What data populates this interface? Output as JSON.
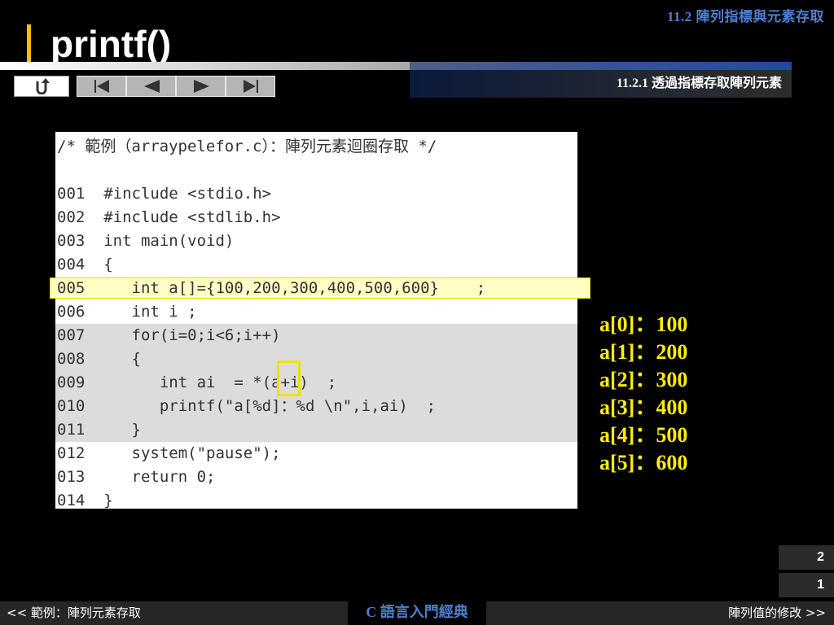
{
  "header": {
    "chapter": "11.2  陣列指標與元素存取",
    "title": "printf()",
    "subsection": "11.2.1 透過指標存取陣列元素"
  },
  "nav": {
    "back_icon": "return-arrow-icon",
    "controls": [
      "first-slide-icon",
      "previous-slide-icon",
      "next-slide-icon",
      "last-slide-icon"
    ]
  },
  "code": {
    "comment": "/* 範例（arraypelefor.c）：陣列元素迴圈存取 */",
    "lines": [
      "001  #include <stdio.h>",
      "002  #include <stdlib.h>",
      "003  int main(void)",
      "004  {",
      "005     int a[]={100,200,300,400,500,600}    ;",
      "006     int i ;",
      "007     for(i=0;i<6;i++)",
      "008     {",
      "009        int ai  = *(a+i)  ;",
      "010        printf(\"a[%d]：%d \\n\",i,ai)  ;",
      "011     }",
      "012     system(\"pause\");",
      "013     return 0;",
      "014  }"
    ]
  },
  "output": [
    "a[0]：100",
    "a[1]：200",
    "a[2]：300",
    "a[3]：400",
    "a[4]：500",
    "a[5]：600"
  ],
  "pages": [
    "2",
    "1"
  ],
  "footer": {
    "prev": "<< 範例：陣列元素存取",
    "book": "C 語言入門經典",
    "next": "陣列值的修改 >>"
  },
  "colors": {
    "accent_yellow": "#ffee00",
    "chapter_blue": "#4f7fd0",
    "title_bar": "#f2c200"
  }
}
